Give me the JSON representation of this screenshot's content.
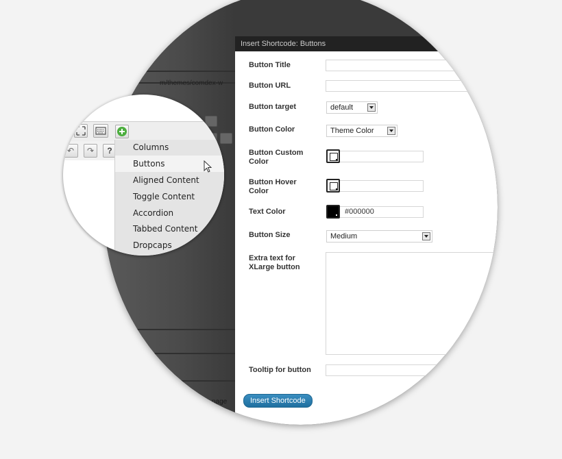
{
  "background": {
    "path_text": "m/themes/comdex-w",
    "page_text": "nage"
  },
  "modal": {
    "title": "Insert Shortcode: Buttons",
    "fields": {
      "button_title": {
        "label": "Button Title",
        "value": ""
      },
      "button_url": {
        "label": "Button URL",
        "value": ""
      },
      "button_target": {
        "label": "Button target",
        "value": "default"
      },
      "button_color": {
        "label": "Button Color",
        "value": "Theme Color"
      },
      "button_custom_color": {
        "label": "Button Custom Color",
        "value": ""
      },
      "button_hover_color": {
        "label": "Button Hover Color",
        "value": ""
      },
      "text_color": {
        "label": "Text Color",
        "value": "#000000"
      },
      "button_size": {
        "label": "Button Size",
        "value": "Medium"
      },
      "extra_text": {
        "label": "Extra text for XLarge button",
        "value": ""
      },
      "tooltip": {
        "label": "Tooltip for button",
        "value": ""
      }
    },
    "submit_label": "Insert Shortcode"
  },
  "shortcode_menu": {
    "items": [
      "Columns",
      "Buttons",
      "Aligned Content",
      "Toggle Content",
      "Accordion",
      "Tabbed Content",
      "Dropcaps"
    ],
    "hovered": "Buttons"
  },
  "icons": [
    "fullscreen-icon",
    "keyboard-icon",
    "add-shortcode-icon",
    "undo-icon",
    "redo-icon",
    "help-icon",
    "mouse-cursor-icon"
  ],
  "colors": {
    "titlebar": "#222222",
    "button": "#2a7fb0",
    "plus_icon": "#4cae3e",
    "text_color_swatch": "#000000"
  }
}
